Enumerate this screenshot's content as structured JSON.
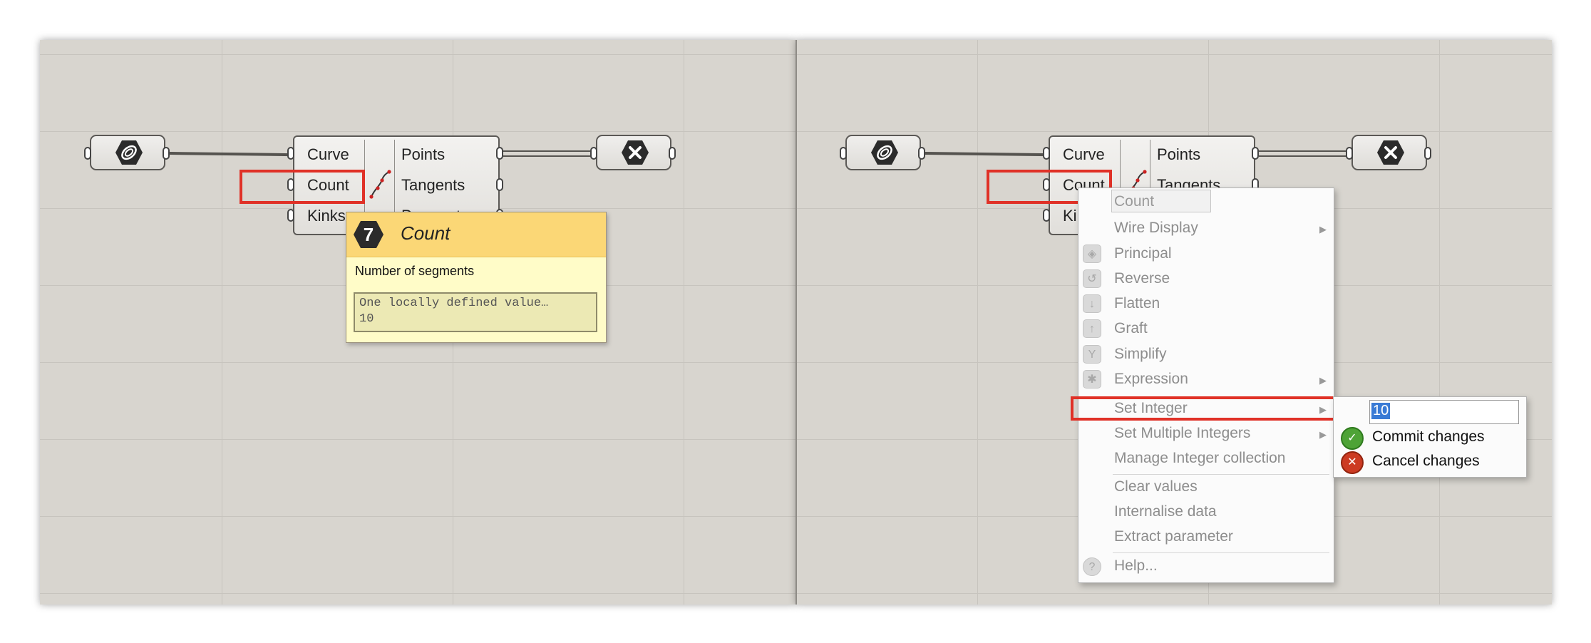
{
  "left_panel": {
    "component": {
      "inputs": [
        "Curve",
        "Count",
        "Kinks"
      ],
      "outputs": [
        "Points",
        "Tangents",
        "Parameters"
      ]
    },
    "tooltip": {
      "badge": "7",
      "title": "Count",
      "description": "Number of segments",
      "value_line1": "One locally defined value…",
      "value_line2": "10"
    }
  },
  "right_panel": {
    "component": {
      "inputs": [
        "Curve",
        "Count",
        "Kinks"
      ],
      "outputs": [
        "Points",
        "Tangents"
      ]
    },
    "context_menu": {
      "title": "Count",
      "items": [
        {
          "label": "Wire Display",
          "submenu": true
        },
        {
          "label": "Principal",
          "icon": "principal-icon"
        },
        {
          "label": "Reverse",
          "icon": "reverse-icon"
        },
        {
          "label": "Flatten",
          "icon": "flatten-icon"
        },
        {
          "label": "Graft",
          "icon": "graft-icon"
        },
        {
          "label": "Simplify",
          "icon": "simplify-icon"
        },
        {
          "label": "Expression",
          "icon": "expression-icon",
          "submenu": true
        },
        {
          "label": "Set Integer",
          "submenu": true
        },
        {
          "label": "Set Multiple Integers",
          "submenu": true
        },
        {
          "label": "Manage Integer collection"
        },
        {
          "label": "Clear values"
        },
        {
          "label": "Internalise data"
        },
        {
          "label": "Extract parameter"
        },
        {
          "label": "Help...",
          "icon": "help-icon"
        }
      ]
    },
    "submenu": {
      "input_value": "10",
      "commit_label": "Commit changes",
      "cancel_label": "Cancel changes"
    }
  },
  "colors": {
    "canvas": "#d8d5cf",
    "highlight": "#e03127",
    "tooltip_header": "#fbd776",
    "tooltip_body": "#fffcc8"
  }
}
